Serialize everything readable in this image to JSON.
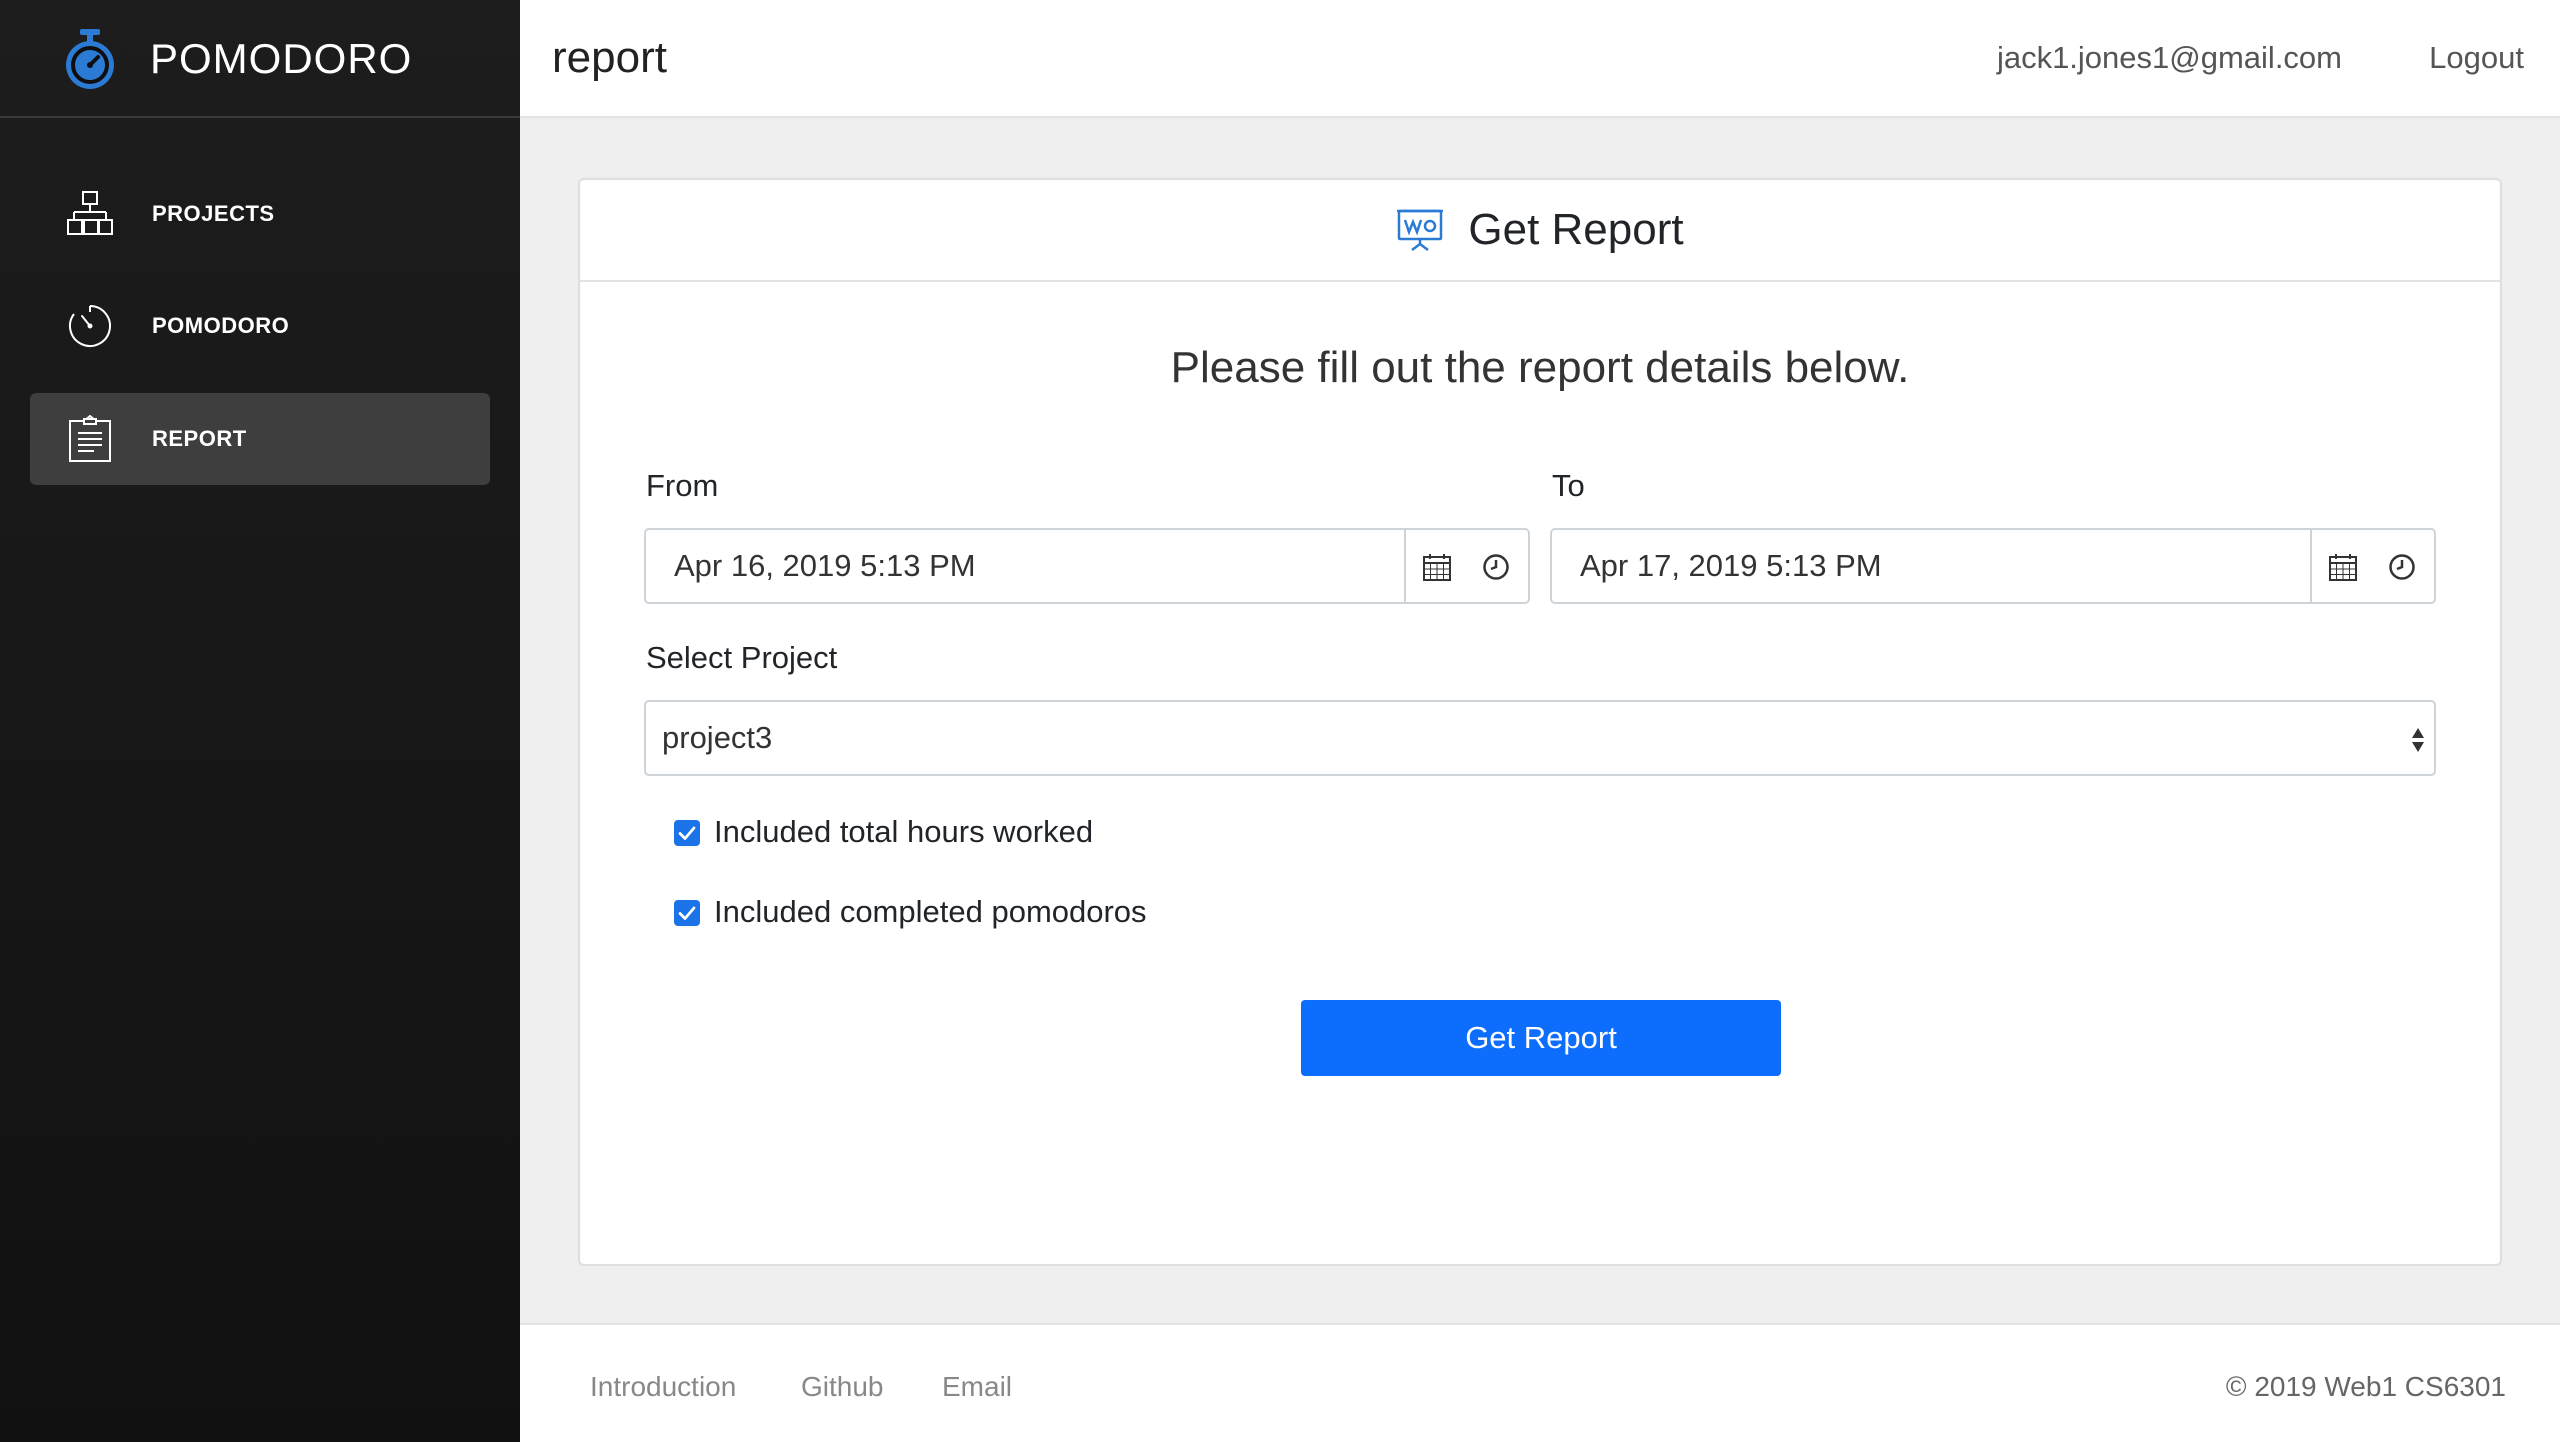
{
  "app": {
    "title": "POMODORO",
    "accent_color": "#2b7bd4"
  },
  "sidebar": {
    "items": [
      {
        "label": "PROJECTS",
        "icon": "projects-icon",
        "active": false
      },
      {
        "label": "POMODORO",
        "icon": "timer-icon",
        "active": false
      },
      {
        "label": "REPORT",
        "icon": "clipboard-icon",
        "active": true
      }
    ]
  },
  "header": {
    "title": "report",
    "email": "jack1.jones1@gmail.com",
    "logout_label": "Logout"
  },
  "card": {
    "title": "Get Report",
    "icon": "presentation-chart-icon",
    "subtitle": "Please fill out the report details below.",
    "from": {
      "label": "From",
      "value": "Apr 16, 2019 5:13 PM"
    },
    "to": {
      "label": "To",
      "value": "Apr 17, 2019 5:13 PM"
    },
    "project": {
      "label": "Select Project",
      "value": "project3"
    },
    "checks": [
      {
        "label": "Included total hours worked",
        "checked": true
      },
      {
        "label": "Included completed pomodoros",
        "checked": true
      }
    ],
    "button_label": "Get Report",
    "button_color": "#0d6efd"
  },
  "footer": {
    "links": [
      "Introduction",
      "Github",
      "Email"
    ],
    "copyright": "© 2019 Web1 CS6301"
  }
}
